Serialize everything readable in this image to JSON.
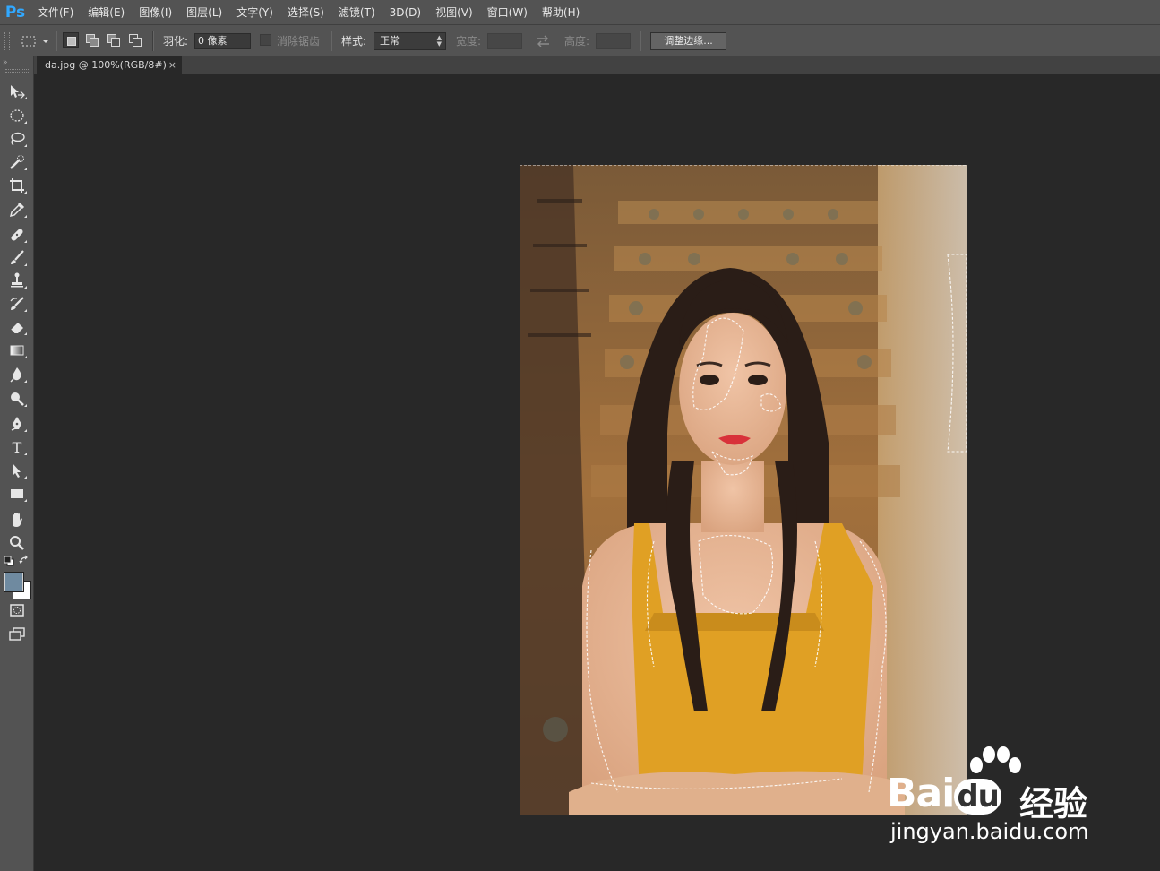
{
  "app": {
    "logo": "Ps"
  },
  "menu": [
    "文件(F)",
    "编辑(E)",
    "图像(I)",
    "图层(L)",
    "文字(Y)",
    "选择(S)",
    "滤镜(T)",
    "3D(D)",
    "视图(V)",
    "窗口(W)",
    "帮助(H)"
  ],
  "options": {
    "feather_label": "羽化:",
    "feather_value": "0 像素",
    "antialias_label": "消除锯齿",
    "style_label": "样式:",
    "style_value": "正常",
    "width_label": "宽度:",
    "height_label": "高度:",
    "refine_edge_button": "调整边缘..."
  },
  "document": {
    "tab_title": "da.jpg @ 100%(RGB/8#)",
    "close_glyph": "×"
  },
  "colors": {
    "foreground": "#6f8aa0",
    "background": "#ffffff"
  },
  "tools": [
    "move-icon",
    "elliptical-marquee-icon",
    "lasso-icon",
    "quick-selection-icon",
    "crop-icon",
    "eyedropper-icon",
    "healing-brush-icon",
    "brush-icon",
    "clone-stamp-icon",
    "history-brush-icon",
    "eraser-icon",
    "gradient-icon",
    "blur-icon",
    "dodge-icon",
    "pen-icon",
    "type-icon",
    "path-selection-icon",
    "rectangle-icon",
    "hand-icon",
    "zoom-icon"
  ],
  "watermark": {
    "brand": "Bai",
    "brand_suffix": "du",
    "cn": "经验",
    "url": "jingyan.baidu.com"
  }
}
